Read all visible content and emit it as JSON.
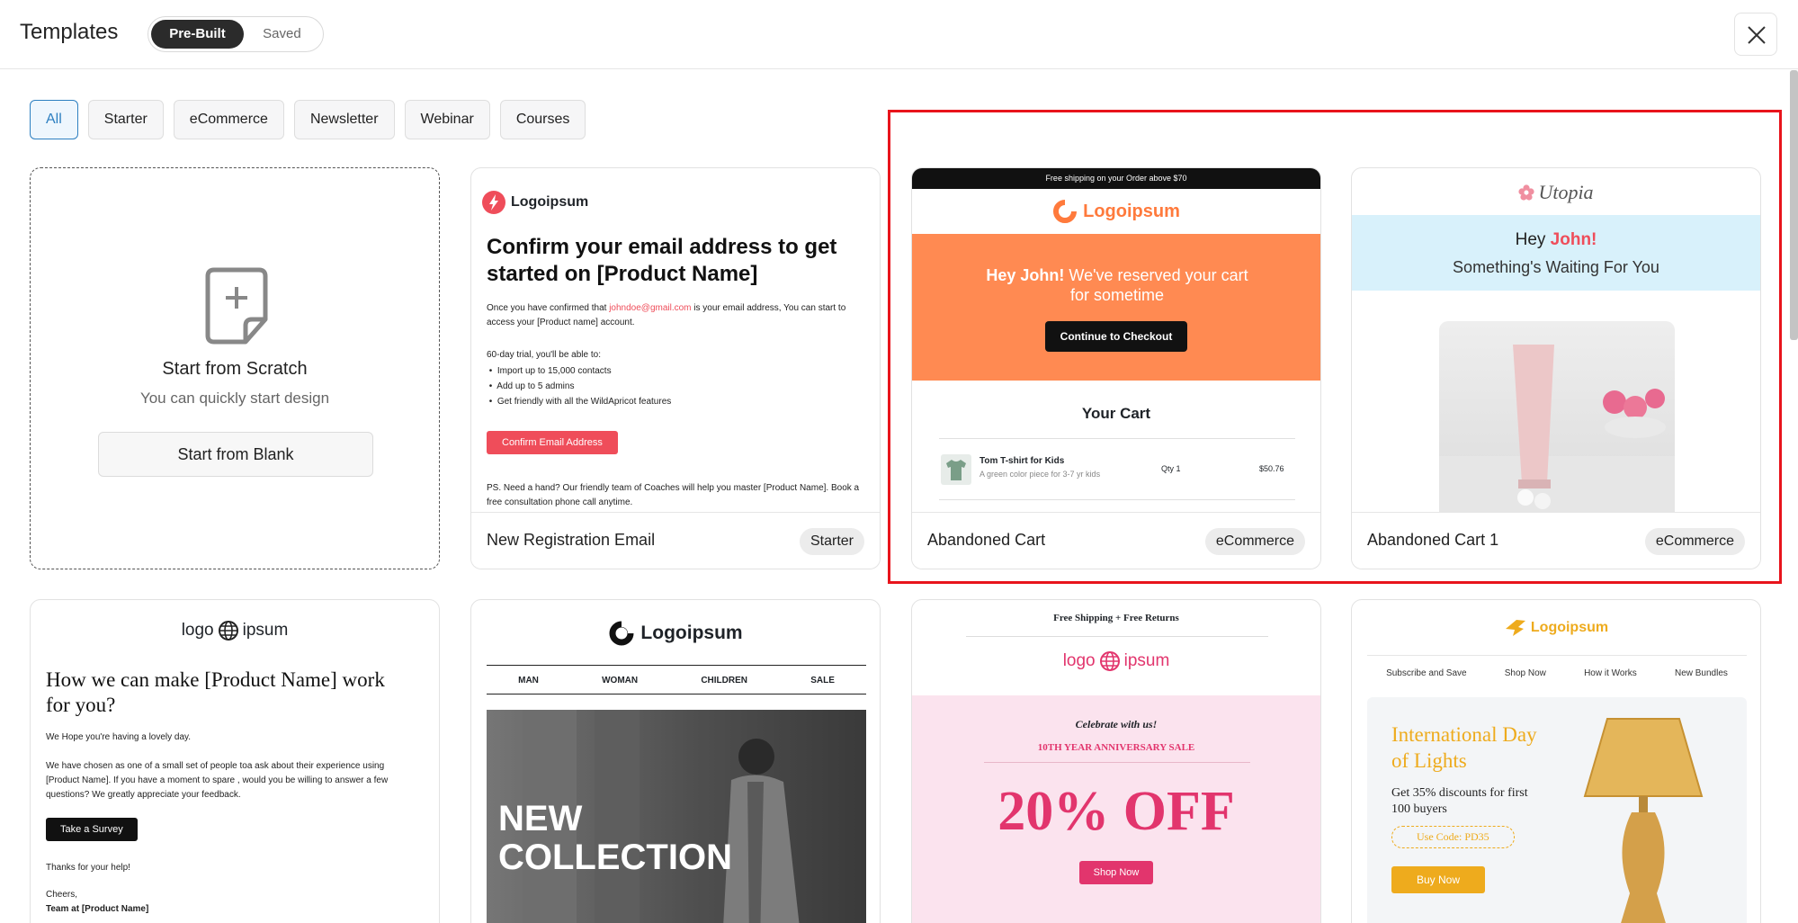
{
  "header": {
    "title": "Templates",
    "toggle": {
      "active": "Pre-Built",
      "inactive": "Saved"
    }
  },
  "filters": [
    "All",
    "Starter",
    "eCommerce",
    "Newsletter",
    "Webinar",
    "Courses"
  ],
  "scratch": {
    "heading": "Start from Scratch",
    "subtext": "You can quickly start design",
    "button": "Start from Blank"
  },
  "cards": [
    {
      "name": "New Registration Email",
      "tag": "Starter",
      "preview": {
        "logo": "Logoipsum",
        "headline": "Confirm your email address to get started on [Product Name]",
        "p1_pre": "Once you have confirmed that",
        "p1_email": "johndoe@gmail.com",
        "p1_post": "is  your email address, You can start to access your [Product name] account.",
        "trial": "60-day trial, you'll be able to:",
        "bullets": [
          "Import up to 15,000 contacts",
          "Add up to 5 admins",
          "Get friendly with all the WildApricot features"
        ],
        "button": "Confirm Email Address",
        "ps": "PS. Need a hand? Our friendly team of Coaches will help you master [Product Name]. Book a free consultation phone call anytime."
      }
    },
    {
      "name": "Abandoned Cart",
      "tag": "eCommerce",
      "preview": {
        "topbar": "Free shipping on your Order above $70",
        "logo": "Logoipsum",
        "hey": "Hey John!",
        "hero_rest": "We've reserved your cart for sometime",
        "button": "Continue to Checkout",
        "cart_title": "Your Cart",
        "item_name": "Tom T-shirt for Kids",
        "item_desc": "A green color piece for 3-7 yr kids",
        "qty": "Qty 1",
        "price": "$50.76"
      }
    },
    {
      "name": "Abandoned Cart 1",
      "tag": "eCommerce",
      "preview": {
        "logo": "Utopia",
        "hey": "Hey",
        "name": "John!",
        "sub": "Something's Waiting For You"
      }
    },
    {
      "preview": {
        "logo_left": "logo",
        "logo_right": "ipsum",
        "headline": "How we can make [Product Name] work for you?",
        "p1": "We Hope you're having a lovely day.",
        "p2": "We have chosen as one of a small set of people toa ask about their  experience using [Product Name]. If you have a moment to spare , would you be willing to answer a few questions? We greatly appreciate your feedback.",
        "button": "Take a Survey",
        "thanks": "Thanks for your help!",
        "cheers": "Cheers,",
        "team": "Team at [Product Name]"
      }
    },
    {
      "preview": {
        "logo": "Logoipsum",
        "nav": [
          "MAN",
          "WOMAN",
          "CHILDREN",
          "SALE"
        ],
        "hero_line1": "NEW",
        "hero_line2": "COLLECTION"
      }
    },
    {
      "preview": {
        "top": "Free Shipping  +  Free Returns",
        "logo_left": "logo",
        "logo_right": "ipsum",
        "celebrate": "Celebrate with us!",
        "anniv": "10TH YEAR ANNIVERSARY SALE",
        "off": "20% OFF",
        "button": "Shop Now"
      }
    },
    {
      "preview": {
        "logo": "Logoipsum",
        "nav": [
          "Subscribe and Save",
          "Shop Now",
          "How it Works",
          "New Bundles"
        ],
        "title": "International Day of Lights",
        "offer": "Get 35% discounts for first 100 buyers",
        "code": "Use Code: PD35",
        "button": "Buy Now"
      }
    }
  ],
  "colors": {
    "accent_blue": "#2d7fc1",
    "highlight_red": "#e8141c",
    "cart_orange": "#ff8a52",
    "utopia_cyan": "#d8f1fb",
    "sale_pink": "#e2356d",
    "gold": "#eeab1d"
  },
  "icons": [
    "close-icon",
    "add-document-icon"
  ]
}
